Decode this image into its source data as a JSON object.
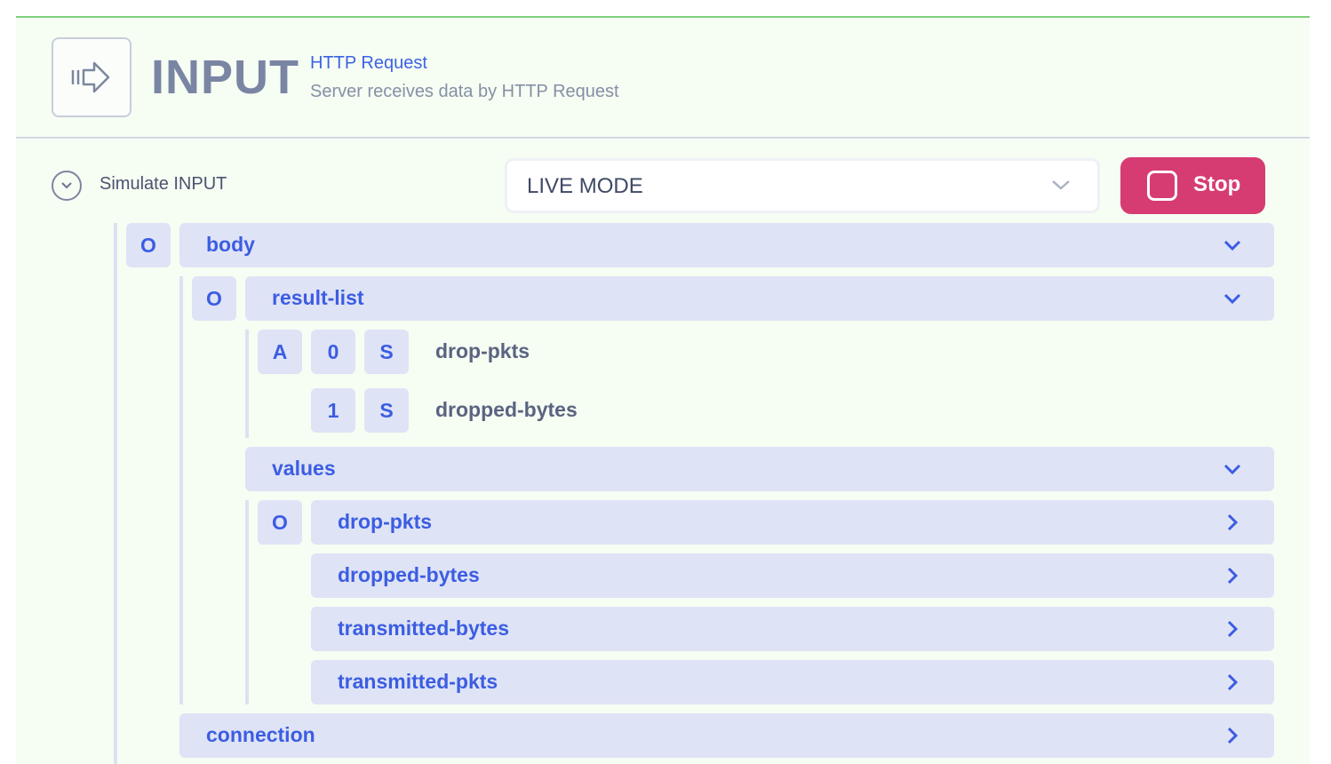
{
  "header": {
    "title": "INPUT",
    "subtitle": "HTTP Request",
    "description": "Server receives data by HTTP Request",
    "icon": "arrow-input-icon"
  },
  "simulate": {
    "label": "Simulate INPUT",
    "mode_value": "LIVE MODE",
    "stop_label": "Stop"
  },
  "tree": {
    "body": {
      "badge": "O",
      "label": "body"
    },
    "result_list": {
      "badge": "O",
      "label": "result-list"
    },
    "result_items": [
      {
        "badges": [
          "A",
          "0",
          "S"
        ],
        "label": "drop-pkts"
      },
      {
        "badges": [
          "1",
          "S"
        ],
        "label": "dropped-bytes"
      }
    ],
    "values": {
      "label": "values",
      "badge": "O"
    },
    "value_items": [
      {
        "label": "drop-pkts"
      },
      {
        "label": "dropped-bytes"
      },
      {
        "label": "transmitted-bytes"
      },
      {
        "label": "transmitted-pkts"
      }
    ],
    "connection": {
      "label": "connection"
    }
  },
  "colors": {
    "accent": "#3b5de2",
    "stop": "#d63c72",
    "panel_bg": "#f6fdf3",
    "top_border": "#7fd07a"
  }
}
